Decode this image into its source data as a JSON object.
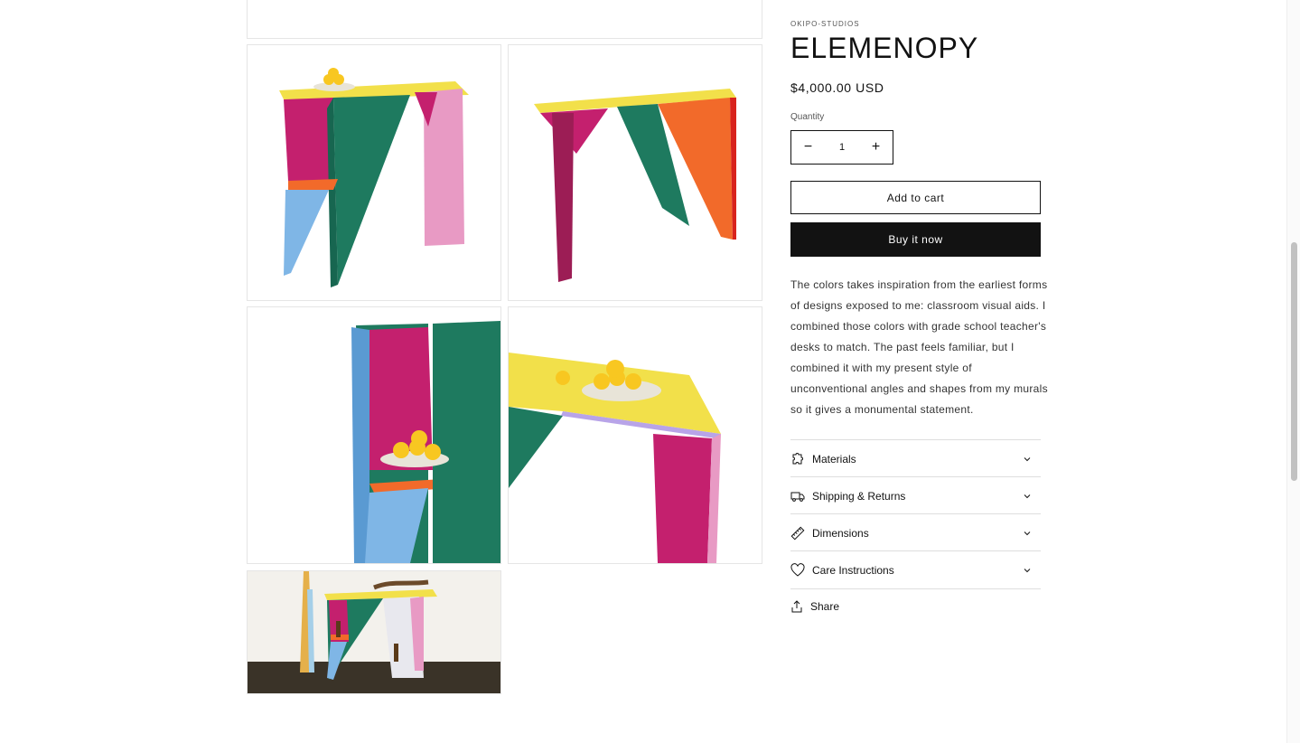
{
  "product": {
    "vendor": "OKIPO-STUDIOS",
    "title": "ELEMENOPY",
    "price": "$4,000.00 USD",
    "quantity_label": "Quantity",
    "quantity_value": "1",
    "decrease_glyph": "−",
    "increase_glyph": "+",
    "add_to_cart": "Add to cart",
    "buy_now": "Buy it now",
    "description": "The colors takes inspiration from the earliest forms of designs exposed to me: classroom visual aids. I combined those colors with grade school teacher's desks to match. The past feels familiar, but I combined it with my present style of unconventional angles and shapes from my murals so it gives a monumental statement."
  },
  "accordions": [
    {
      "label": "Materials",
      "icon": "puzzle-icon"
    },
    {
      "label": "Shipping & Returns",
      "icon": "truck-icon"
    },
    {
      "label": "Dimensions",
      "icon": "ruler-icon"
    },
    {
      "label": "Care Instructions",
      "icon": "heart-icon"
    }
  ],
  "share": {
    "label": "Share",
    "icon": "share-icon"
  },
  "gallery": [
    {
      "name": "product-image-top"
    },
    {
      "name": "product-image-1"
    },
    {
      "name": "product-image-2"
    },
    {
      "name": "product-image-3"
    },
    {
      "name": "product-image-4"
    },
    {
      "name": "product-image-5"
    }
  ],
  "colors": {
    "yellow": "#f2e04a",
    "magenta": "#c4206e",
    "green": "#1e7a5f",
    "pink": "#e89ac4",
    "blue": "#7fb6e6",
    "orange": "#f26a2a",
    "lemon": "#f8c721",
    "dark": "#121212"
  }
}
